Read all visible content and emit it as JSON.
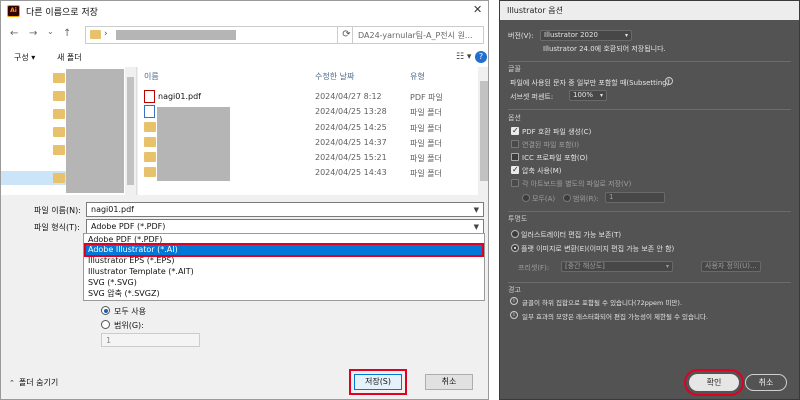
{
  "save_dialog": {
    "app_icon_text": "Ai",
    "title": "다른 이름으로 저장",
    "close": "✕",
    "nav": {
      "back": "←",
      "forward": "→",
      "dropdown": "⌄",
      "up": "↑",
      "chevron": "›",
      "refresh": "⟳"
    },
    "search_placeholder": "DA24-yarnular팀-A_P전시 원...",
    "toolbar": {
      "organize": "구성 ▾",
      "new_folder": "새 폴더",
      "view": "☷ ▾",
      "help": "?"
    },
    "columns": {
      "name": "이름",
      "date": "수정한 날짜",
      "type": "유형"
    },
    "files": [
      {
        "name": "nagi01.pdf",
        "date": "2024/04/27 8:12",
        "type": "PDF 파일"
      },
      {
        "name": "",
        "date": "2024/04/25 13:28",
        "type": "파일 폴더"
      },
      {
        "name": "",
        "date": "2024/04/25 14:25",
        "type": "파일 폴더"
      },
      {
        "name": "",
        "date": "2024/04/25 14:37",
        "type": "파일 폴더"
      },
      {
        "name": "",
        "date": "2024/04/25 15:21",
        "type": "파일 폴더"
      },
      {
        "name": "",
        "date": "2024/04/25 14:43",
        "type": "파일 폴더"
      }
    ],
    "filename_label": "파일 이름(N):",
    "filename_value": "nagi01.pdf",
    "filetype_label": "파일 형식(T):",
    "filetype_value": "Adobe PDF (*.PDF)",
    "filetype_options": [
      "Adobe PDF (*.PDF)",
      "Adobe Illustrator (*.AI)",
      "Illustrator EPS (*.EPS)",
      "Illustrator Template (*.AIT)",
      "SVG (*.SVG)",
      "SVG 압축 (*.SVGZ)"
    ],
    "use_all_label": "모두 사용",
    "range_label": "범위(G):",
    "range_value": "1",
    "hide_folders": "폴더 숨기기",
    "save_button": "저장(S)",
    "cancel_button": "취소"
  },
  "illustrator_options": {
    "title": "Illustrator 옵션",
    "version_label": "버전(V):",
    "version_value": "Illustrator 2020",
    "version_note": "Illustrator 24.0에 호환되어 저장됩니다.",
    "fonts_header": "글꼴",
    "subset_text": "파일에 사용된 문자 중 일부만 포함할 때(Subsetting)",
    "subset_pct_label": "서브셋 퍼센트:",
    "subset_pct_value": "100%",
    "options_header": "옵션",
    "create_pdf": "PDF 호환 파일 생성(C)",
    "include_linked": "연결된 파일 포함(I)",
    "include_icc": "ICC 프로파일 포함(O)",
    "use_compression": "압축 사용(M)",
    "save_artboards": "각 아트보드를 별도의 파일로 저장(V)",
    "all_label": "모두(A)",
    "range_label": "범위(R):",
    "range_value": "1",
    "transparency_header": "투명도",
    "preserve_paths": "일러스트레이터 편집 가능 보존(T)",
    "preserve_appearance": "플랫 이미지로 변환(E)(이미지 편집 가능 보존 안 함)",
    "preset_label": "프리셋(F):",
    "preset_value": "[중간 해상도]",
    "custom_button": "사용자 정의(U)...",
    "warnings_header": "경고",
    "warning_1": "글꼴이 하위 집합으로 포함될 수 있습니다(72ppem 미만).",
    "warning_2": "일부 효과의 모양은 래스터화되어 편집 가능성이 제한될 수 있습니다.",
    "ok_button": "확인",
    "cancel_button": "취소"
  },
  "colors": {
    "selection_blue": "#0078d7",
    "highlight_red": "#e00022",
    "ai_panel": "#535353"
  }
}
